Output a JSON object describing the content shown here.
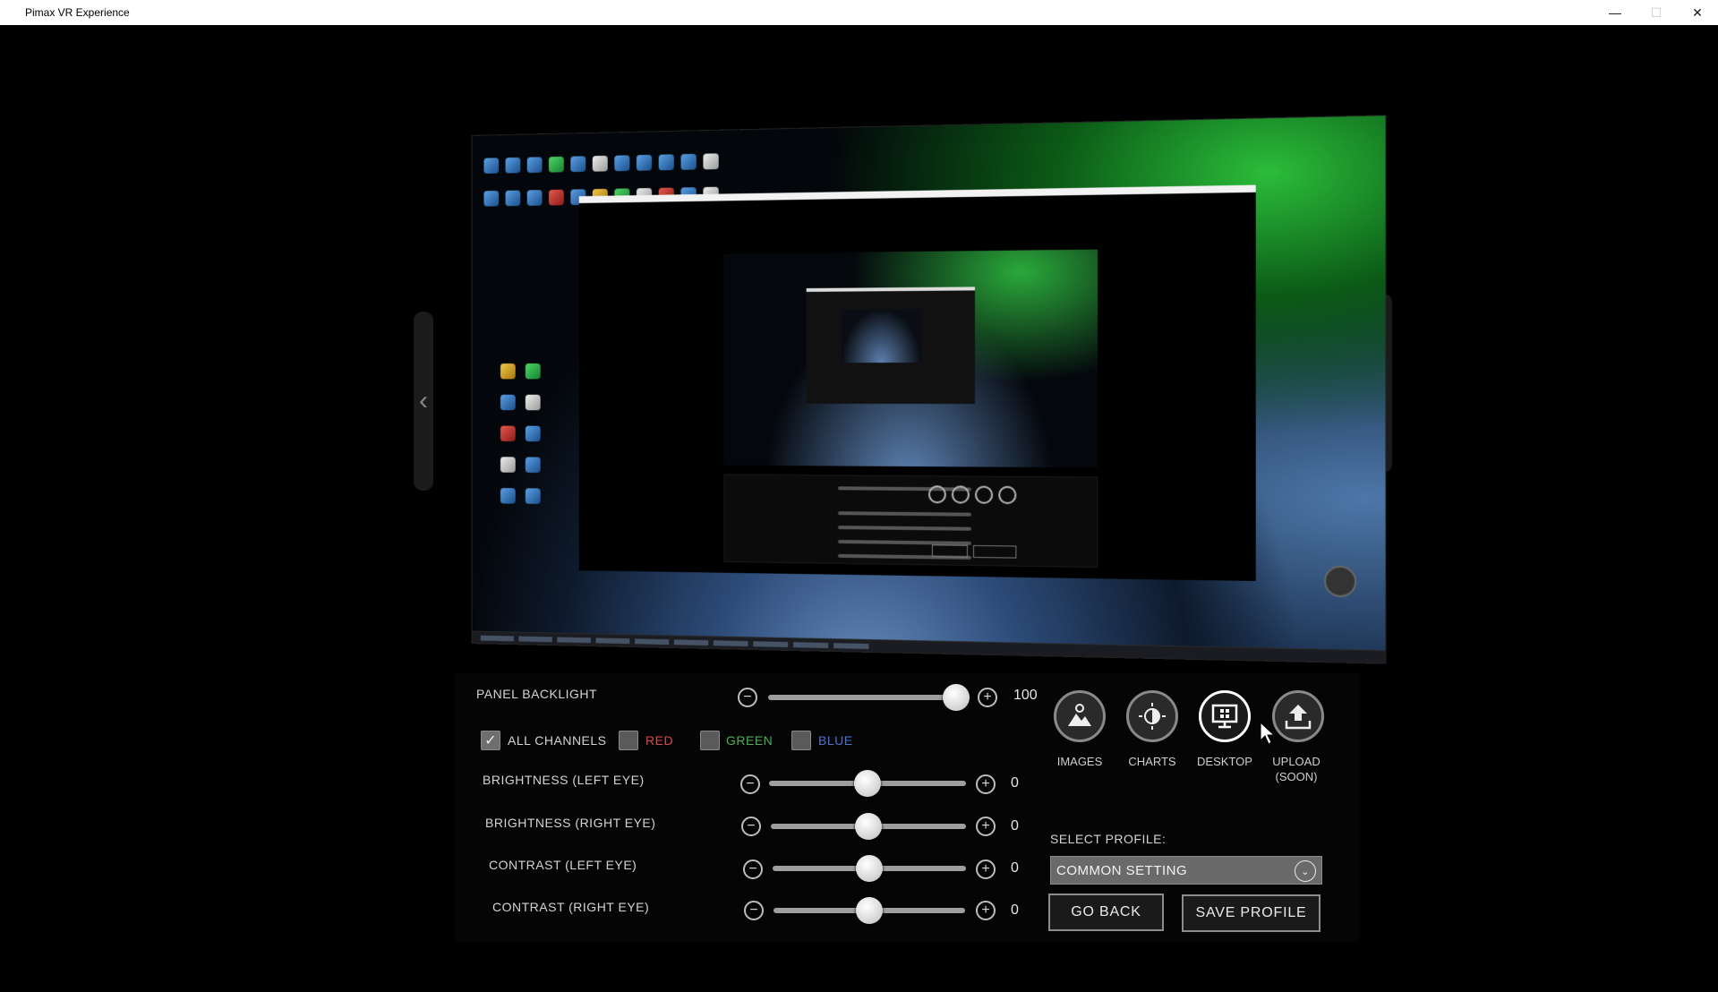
{
  "window": {
    "title": "Pimax VR Experience",
    "minimize": "—",
    "maximize": "☐",
    "close": "✕"
  },
  "nav": {
    "prev": "‹",
    "next": "›"
  },
  "panel_backlight": {
    "label": "PANEL BACKLIGHT",
    "value": "100",
    "level": 1.0
  },
  "channels": {
    "all": "ALL CHANNELS",
    "all_checked": true,
    "red": "RED",
    "green": "GREEN",
    "blue": "BLUE",
    "red_color": "#d24a4a",
    "green_color": "#4caf50",
    "blue_color": "#4a72d2"
  },
  "sliders": [
    {
      "label": "BRIGHTNESS (LEFT EYE)",
      "value": "0",
      "level": 0.5
    },
    {
      "label": "BRIGHTNESS (RIGHT EYE)",
      "value": "0",
      "level": 0.5
    },
    {
      "label": "CONTRAST (LEFT EYE)",
      "value": "0",
      "level": 0.5
    },
    {
      "label": "CONTRAST (RIGHT EYE)",
      "value": "0",
      "level": 0.5
    }
  ],
  "modes": [
    {
      "label": "IMAGES",
      "icon": "images-icon"
    },
    {
      "label": "CHARTS",
      "icon": "charts-icon"
    },
    {
      "label": "DESKTOP",
      "icon": "desktop-icon",
      "active": true
    },
    {
      "label": "UPLOAD\n(SOON)",
      "icon": "upload-icon"
    }
  ],
  "profile": {
    "label": "SELECT PROFILE:",
    "selected": "COMMON SETTING"
  },
  "buttons": {
    "go_back": "GO BACK",
    "save_profile": "SAVE PROFILE"
  },
  "glyphs": {
    "minus": "−",
    "plus": "+",
    "check": "✓",
    "chevron": "⌄"
  }
}
